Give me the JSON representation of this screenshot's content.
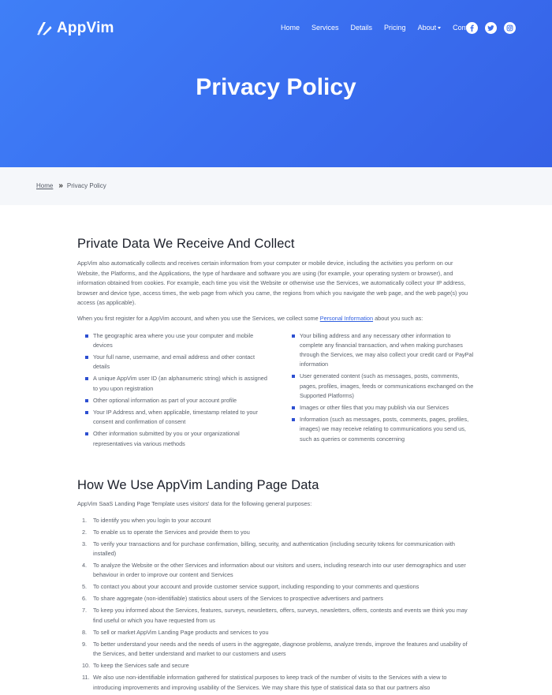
{
  "brand": {
    "name": "AppVim"
  },
  "nav": {
    "items": [
      {
        "label": "Home"
      },
      {
        "label": "Services"
      },
      {
        "label": "Details"
      },
      {
        "label": "Pricing"
      },
      {
        "label": "About"
      },
      {
        "label": "Contact"
      }
    ],
    "socials": [
      "facebook-icon",
      "twitter-icon",
      "instagram-icon"
    ]
  },
  "hero": {
    "title": "Privacy Policy"
  },
  "breadcrumb": {
    "home": "Home",
    "current": "Privacy Policy"
  },
  "section1": {
    "heading": "Private Data We Receive And Collect",
    "para1": "AppVim also automatically collects and receives certain information from your computer or mobile device, including the activities you perform on our Website, the Platforms, and the Applications, the type of hardware and software you are using (for example, your operating system or browser), and information obtained from cookies. For example, each time you visit the Website or otherwise use the Services, we automatically collect your IP address, browser and device type, access times, the web page from which you came, the regions from which you navigate the web page, and the web page(s) you access (as applicable).",
    "para2_before": "When you first register for a AppVim account, and when you use the Services, we collect some ",
    "para2_link": "Personal Information",
    "para2_after": " about you such as:",
    "left_list": [
      "The geographic area where you use your computer and mobile devices",
      "Your full name, username, and email address and other contact details",
      "A unique AppVim user ID (an alphanumeric string) which is assigned to you upon registration",
      "Other optional information as part of your account profile",
      "Your IP Address and, when applicable, timestamp related to your consent and confirmation of consent",
      "Other information submitted by you or your organizational representatives via various methods"
    ],
    "right_list": [
      "Your billing address and any necessary other information to complete any financial transaction, and when making purchases through the Services, we may also collect your credit card or PayPal information",
      "User generated content (such as messages, posts, comments, pages, profiles, images, feeds or communications exchanged on the Supported Platforms)",
      "Images or other files that you may publish via our Services",
      "Information (such as messages, posts, comments, pages, profiles, images) we may receive relating to communications you send us, such as queries or comments concerning"
    ]
  },
  "section2": {
    "heading": "How We Use AppVim Landing Page Data",
    "intro": "AppVim SaaS Landing Page Template uses visitors' data for the following general purposes:",
    "items": [
      "To identify you when you login to your account",
      "To enable us to operate the Services and provide them to you",
      "To verify your transactions and for purchase confirmation, billing, security, and authentication (including security tokens for communication with installed)",
      "To analyze the Website or the other Services and information about our visitors and users, including research into our user demographics and user behaviour in order to improve our content and Services",
      "To contact you about your account and provide customer service support, including responding to your comments and questions",
      "To share aggregate (non-identifiable) statistics about users of the Services to prospective advertisers and partners",
      "To keep you informed about the Services, features, surveys, newsletters, offers, surveys, newsletters, offers, contests and events we think you may find useful or which you have requested from us",
      "To sell or market AppVim Landing Page products and services to you",
      "To better understand your needs and the needs of users in the aggregate, diagnose problems, analyze trends, improve the features and usability of the Services, and better understand and market to our customers and users",
      "To keep the Services safe and secure",
      "We also use non-identifiable information gathered for statistical purposes to keep track of the number of visits to the Services with a view to introducing improvements and improving usability of the Services. We may share this type of statistical data so that our partners also"
    ],
    "numbers": [
      "1.",
      "2.",
      "3.",
      "4.",
      "5.",
      "6.",
      "7.",
      "8.",
      "9.",
      "10.",
      "11."
    ]
  }
}
